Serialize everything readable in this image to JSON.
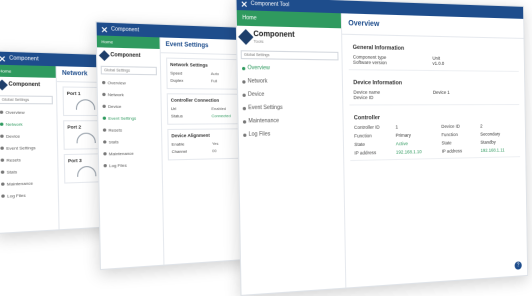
{
  "app": {
    "title": "Component Tool",
    "home_label": "Home",
    "brand_line1": "Component",
    "brand_line2": "Tools",
    "selector": "Global Settings"
  },
  "win1": {
    "title": "Component",
    "sidebar": [
      "Overview",
      "Network",
      "Device",
      "Event Settings",
      "Resets",
      "Stats",
      "Maintenance",
      "Log Files"
    ],
    "page_title": "Network",
    "panels": [
      "Port 1",
      "Port 2",
      "Port 3"
    ]
  },
  "win2": {
    "title": "Component",
    "page_title": "Event Settings",
    "sidebar": [
      "Overview",
      "Network",
      "Device",
      "Event Settings",
      "Resets",
      "Stats",
      "Maintenance",
      "Log Files"
    ],
    "sections": [
      {
        "title": "Network Settings",
        "rows": [
          [
            "Speed",
            "Auto"
          ],
          [
            "Duplex",
            "Full"
          ]
        ]
      },
      {
        "title": "Controller Connection",
        "rows": [
          [
            "Url",
            "Enabled"
          ],
          [
            "Status",
            "Connected"
          ]
        ]
      },
      {
        "title": "Device Alignment",
        "rows": [
          [
            "Enable",
            "Yes"
          ],
          [
            "Channel",
            "00"
          ]
        ]
      }
    ]
  },
  "win3": {
    "title": "Component Tool",
    "page_title": "Overview",
    "sidebar": [
      "Overview",
      "Network",
      "Device",
      "Event Settings",
      "Maintenance",
      "Log Files"
    ],
    "general": {
      "title": "General Information",
      "rows": [
        [
          "Component type",
          "Unit"
        ],
        [
          "Software version",
          "v1.0.0"
        ]
      ]
    },
    "device": {
      "title": "Device Information",
      "rows": [
        [
          "Device name",
          "Device 1"
        ],
        [
          "Device ID",
          ""
        ]
      ]
    },
    "controller": {
      "title": "Controller",
      "left": [
        [
          "Controller ID",
          "1"
        ],
        [
          "Function",
          "Primary"
        ],
        [
          "State",
          "Active"
        ],
        [
          "IP address",
          "192.168.1.10"
        ]
      ],
      "right": [
        [
          "Device ID",
          "2"
        ],
        [
          "Function",
          "Secondary"
        ],
        [
          "State",
          "Standby"
        ],
        [
          "IP address",
          "192.168.1.11"
        ]
      ]
    },
    "help_icon": "?"
  }
}
